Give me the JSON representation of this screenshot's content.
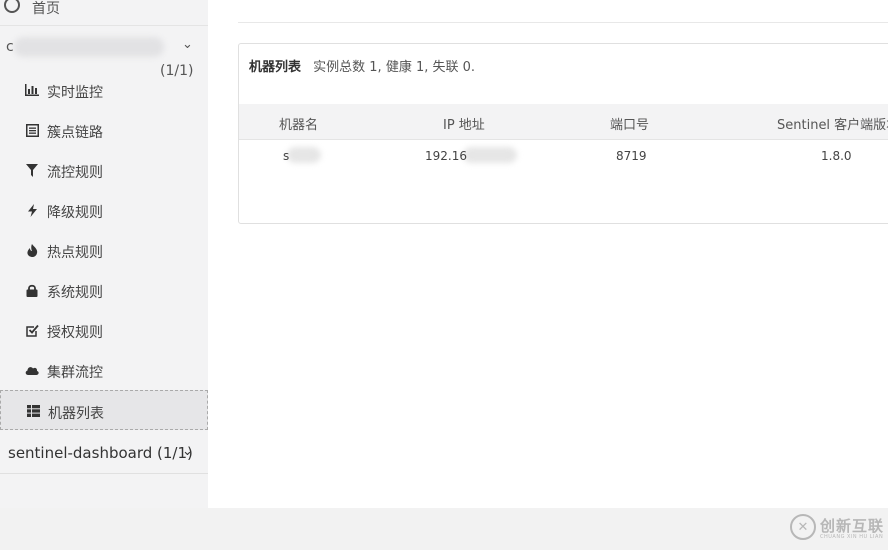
{
  "sidebar": {
    "home_label": "首页",
    "app_group": {
      "name": "c",
      "count": "(1/1)"
    },
    "items": [
      {
        "label": "实时监控",
        "icon": "bar-chart-icon"
      },
      {
        "label": "簇点链路",
        "icon": "list-icon"
      },
      {
        "label": "流控规则",
        "icon": "filter-icon"
      },
      {
        "label": "降级规则",
        "icon": "flash-icon"
      },
      {
        "label": "热点规则",
        "icon": "fire-icon"
      },
      {
        "label": "系统规则",
        "icon": "lock-icon"
      },
      {
        "label": "授权规则",
        "icon": "check-square-icon"
      },
      {
        "label": "集群流控",
        "icon": "cloud-icon"
      },
      {
        "label": "机器列表",
        "icon": "th-list-icon"
      }
    ],
    "active_item": "机器列表",
    "app_group2": {
      "name": "sentinel-dashboard (1/1)"
    }
  },
  "panel": {
    "title": "机器列表",
    "summary": "实例总数 1, 健康 1, 失联 0.",
    "columns": [
      "机器名",
      "IP 地址",
      "端口号",
      "Sentinel 客户端版本"
    ],
    "rows": [
      {
        "machine": "s",
        "ip": "192.16",
        "port": "8719",
        "version": "1.8.0"
      }
    ]
  },
  "watermark": {
    "brand": "创新互联",
    "sub": "CHUANG XIN HU LIAN"
  }
}
